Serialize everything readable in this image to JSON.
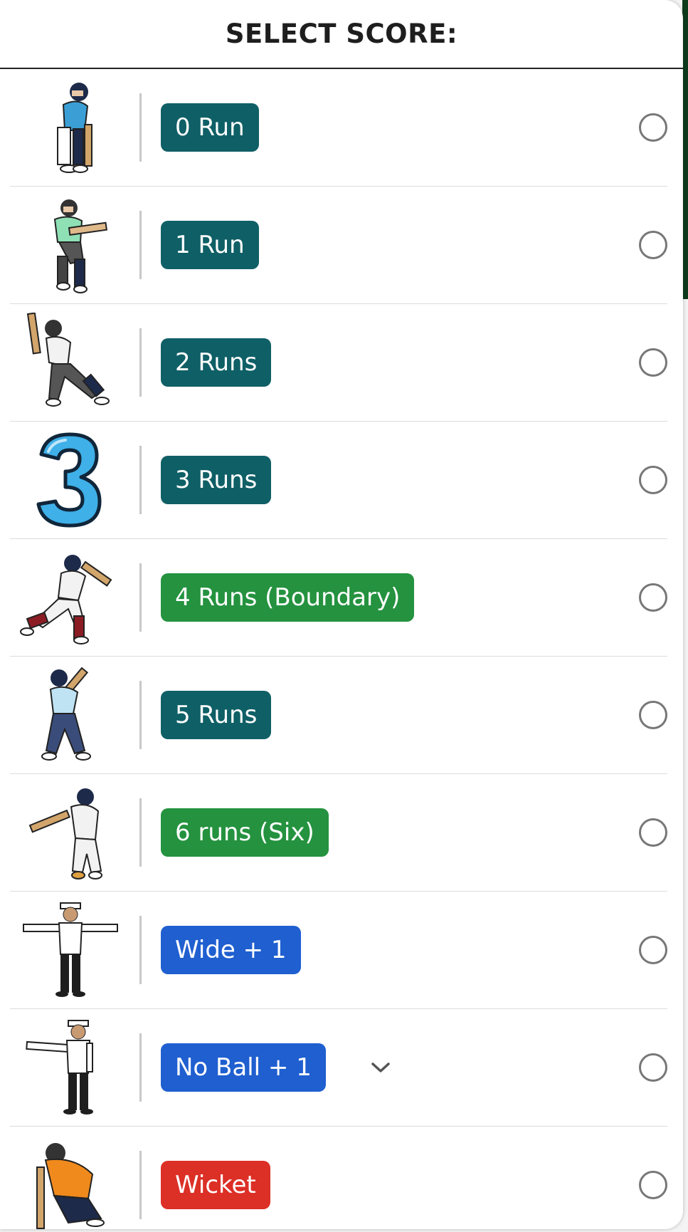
{
  "dialog": {
    "title": "SELECT SCORE:"
  },
  "options": [
    {
      "label": "0 Run",
      "color": "#0f5f66",
      "icon": "batsman-defensive-icon"
    },
    {
      "label": "1 Run",
      "color": "#0f5f66",
      "icon": "batsman-running-icon"
    },
    {
      "label": "2 Runs",
      "color": "#0f5f66",
      "icon": "batsman-stride-icon"
    },
    {
      "label": "3 Runs",
      "color": "#0f5f66",
      "icon": "number-three-icon"
    },
    {
      "label": "4 Runs (Boundary)",
      "color": "#24923f",
      "icon": "batsman-cover-drive-icon"
    },
    {
      "label": "5 Runs",
      "color": "#0f5f66",
      "icon": "batsman-backfoot-icon"
    },
    {
      "label": "6 runs (Six)",
      "color": "#24923f",
      "icon": "batsman-pull-shot-icon"
    },
    {
      "label": "Wide + 1",
      "color": "#1f5fd0",
      "icon": "umpire-wide-signal-icon"
    },
    {
      "label": "No Ball + 1",
      "color": "#1f5fd0",
      "icon": "umpire-no-ball-signal-icon"
    },
    {
      "label": "Wicket",
      "color": "#dc2f26",
      "icon": "batsman-out-icon"
    }
  ]
}
